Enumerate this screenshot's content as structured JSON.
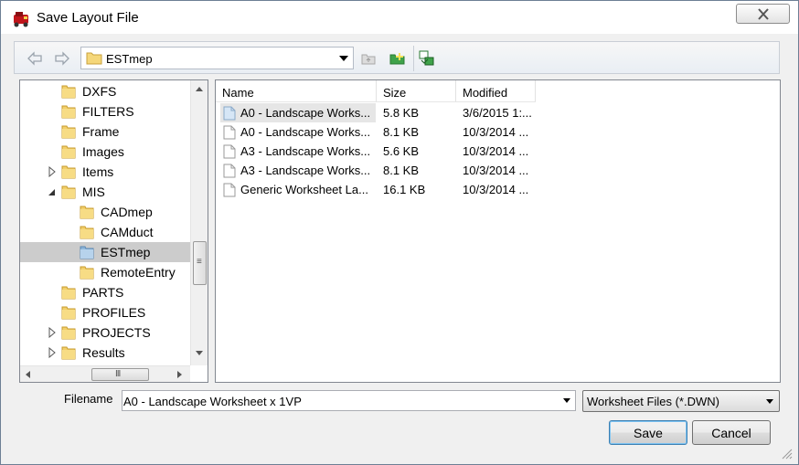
{
  "window": {
    "title": "Save Layout File",
    "close_icon": "close-icon"
  },
  "navbar": {
    "back_icon": "back-arrow-icon",
    "forward_icon": "forward-arrow-icon",
    "current_path": "ESTmep",
    "toolbar_icons": [
      "up-folder-icon",
      "new-folder-icon",
      "view-options-icon"
    ]
  },
  "tree": {
    "items": [
      {
        "label": "DXFS",
        "level": 0,
        "expander": ""
      },
      {
        "label": "FILTERS",
        "level": 0,
        "expander": ""
      },
      {
        "label": "Frame",
        "level": 0,
        "expander": ""
      },
      {
        "label": "Images",
        "level": 0,
        "expander": ""
      },
      {
        "label": "Items",
        "level": 0,
        "expander": "collapsed"
      },
      {
        "label": "MIS",
        "level": 0,
        "expander": "expanded"
      },
      {
        "label": "CADmep",
        "level": 1,
        "expander": ""
      },
      {
        "label": "CAMduct",
        "level": 1,
        "expander": ""
      },
      {
        "label": "ESTmep",
        "level": 1,
        "expander": "",
        "selected": true
      },
      {
        "label": "RemoteEntry",
        "level": 1,
        "expander": ""
      },
      {
        "label": "PARTS",
        "level": 0,
        "expander": ""
      },
      {
        "label": "PROFILES",
        "level": 0,
        "expander": ""
      },
      {
        "label": "PROJECTS",
        "level": 0,
        "expander": "collapsed"
      },
      {
        "label": "Results",
        "level": 0,
        "expander": "collapsed"
      }
    ],
    "hscroll_grip": "III",
    "vscroll_grip": "≡"
  },
  "filelist": {
    "columns": [
      "Name",
      "Size",
      "Modified"
    ],
    "rows": [
      {
        "name": "A0 - Landscape Works...",
        "size": "5.8 KB",
        "modified": "3/6/2015 1:...",
        "highlighted": true
      },
      {
        "name": "A0 - Landscape Works...",
        "size": "8.1 KB",
        "modified": "10/3/2014 ..."
      },
      {
        "name": "A3 - Landscape Works...",
        "size": "5.6 KB",
        "modified": "10/3/2014 ..."
      },
      {
        "name": "A3 - Landscape Works...",
        "size": "8.1 KB",
        "modified": "10/3/2014 ..."
      },
      {
        "name": "Generic Worksheet La...",
        "size": "16.1 KB",
        "modified": "10/3/2014 ..."
      }
    ]
  },
  "footer": {
    "filename_label": "Filename",
    "filename_value": "A0 - Landscape Worksheet x 1VP",
    "filetype": "Worksheet Files (*.DWN)",
    "save_label": "Save",
    "cancel_label": "Cancel"
  },
  "colors": {
    "selected_tree": "#cccccc",
    "highlight_row": "#e6e6e6",
    "default_button_border": "#3c7fb1"
  }
}
